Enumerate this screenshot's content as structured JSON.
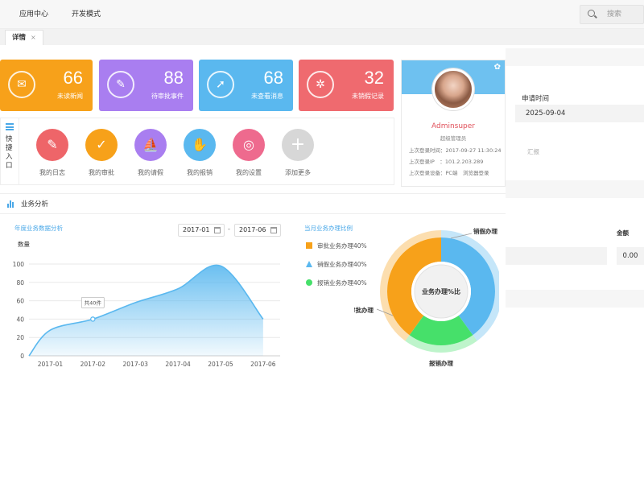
{
  "topbar": {
    "menu": [
      "应用中心",
      "开发模式"
    ],
    "search_placeholder": "搜索"
  },
  "tab": {
    "label": "详情",
    "close": "×"
  },
  "stats": [
    {
      "value": "66",
      "label": "未读新闻",
      "color": "#f7a11a",
      "icon": "news-icon"
    },
    {
      "value": "88",
      "label": "待审批事件",
      "color": "#a97ef0",
      "icon": "edit-icon"
    },
    {
      "value": "68",
      "label": "未查看消息",
      "color": "#5ab8ef",
      "icon": "rocket-icon"
    },
    {
      "value": "32",
      "label": "未销假记录",
      "color": "#ef6a6f",
      "icon": "palm-icon"
    }
  ],
  "quick": {
    "title": "快捷入口",
    "items": [
      {
        "label": "我的日志",
        "color": "#ee6569",
        "icon": "journal-icon"
      },
      {
        "label": "我的审批",
        "color": "#f7a11a",
        "icon": "approval-icon"
      },
      {
        "label": "我的请假",
        "color": "#a97ef0",
        "icon": "sailboat-icon"
      },
      {
        "label": "我的报销",
        "color": "#5ab8ef",
        "icon": "reimburse-icon"
      },
      {
        "label": "我的设置",
        "color": "#ee6a8e",
        "icon": "target-icon"
      },
      {
        "label": "添加更多",
        "color": "#d7d7d7",
        "icon": "plus-icon"
      }
    ]
  },
  "profile": {
    "name": "Adminsuper",
    "role": "超级管理员",
    "info": [
      "上次登录时间：2017-09-27 11:30:24",
      "上次登录IP　：101.2.203.289",
      "上次登录设备：PC端　浏览器登录"
    ]
  },
  "right_panel": {
    "time_label": "申请时间",
    "time_value": "2025-09-04",
    "summary": "汇报",
    "amount_label": "金额",
    "amount_value": "0.00"
  },
  "analysis": {
    "title": "业务分析",
    "line_title": "年度业务数据分析",
    "date_from": "2017-01",
    "date_to": "2017-06",
    "date_sep": "-",
    "ylabel": "数量",
    "tooltip": "共40件",
    "donut_title": "当月业务办理比例",
    "legend": [
      {
        "label": "审批业务办理40%",
        "color": "#f7a11a"
      },
      {
        "label": "销假业务办理40%",
        "color": "#5ab8ef"
      },
      {
        "label": "报销业务办理40%",
        "color": "#46e06a"
      }
    ],
    "donut_center": "业务办理%比"
  },
  "chart_data": [
    {
      "type": "area",
      "title": "年度业务数据分析",
      "ylabel": "数量",
      "categories": [
        "2017-01",
        "2017-02",
        "2017-03",
        "2017-04",
        "2017-05",
        "2017-06"
      ],
      "x": [
        0,
        0.5,
        1.5,
        2.5,
        3.5,
        4.5,
        5.5
      ],
      "values": [
        0,
        28,
        40,
        58,
        73,
        98,
        40
      ],
      "ylim": [
        0,
        100
      ],
      "yticks": [
        0,
        20,
        40,
        60,
        80,
        100
      ],
      "color": "#5ab8ef",
      "grid": true
    },
    {
      "type": "pie",
      "title": "当月业务办理比例",
      "labels": [
        "销假办理",
        "报销办理",
        "审批办理"
      ],
      "values": [
        40,
        20,
        40
      ],
      "colors": [
        "#5ab8ef",
        "#46e06a",
        "#f7a11a"
      ],
      "center_label": "业务办理%比"
    }
  ]
}
